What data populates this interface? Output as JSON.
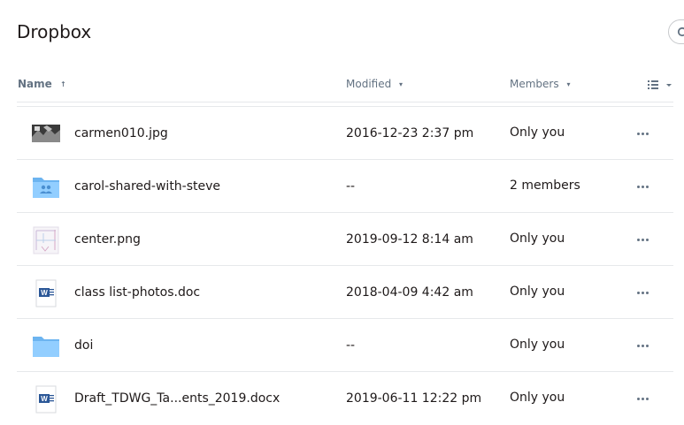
{
  "header": {
    "title": "Dropbox"
  },
  "columns": {
    "name": "Name",
    "modified": "Modified",
    "members": "Members"
  },
  "icons": {
    "search": "search-icon",
    "view": "list-view-icon",
    "more": "more-icon",
    "sort_up": "↑",
    "dropdown": "▾"
  },
  "colors": {
    "folder": "#92ceff",
    "folder_dark": "#6cb4f0",
    "word": "#2b5797",
    "text_secondary": "#637282"
  },
  "rows": [
    {
      "name": "carmen010.jpg",
      "modified": "2016-12-23 2:37 pm",
      "members": "Only you",
      "icon": "image-thumbnail-icon"
    },
    {
      "name": "carol-shared-with-steve",
      "modified": "--",
      "members": "2 members",
      "icon": "shared-folder-icon"
    },
    {
      "name": "center.png",
      "modified": "2019-09-12 8:14 am",
      "members": "Only you",
      "icon": "image-thumbnail-icon"
    },
    {
      "name": "class list-photos.doc",
      "modified": "2018-04-09 4:42 am",
      "members": "Only you",
      "icon": "word-document-icon"
    },
    {
      "name": "doi",
      "modified": "--",
      "members": "Only you",
      "icon": "folder-icon"
    },
    {
      "name": "Draft_TDWG_Ta...ents_2019.docx",
      "modified": "2019-06-11 12:22 pm",
      "members": "Only you",
      "icon": "word-document-icon"
    }
  ]
}
